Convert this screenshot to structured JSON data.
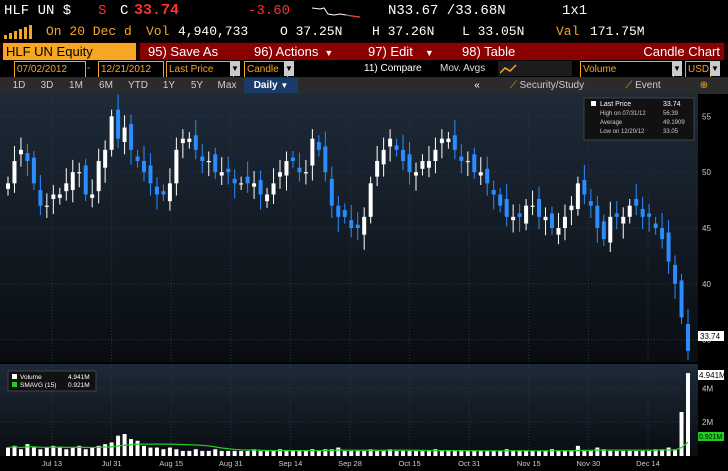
{
  "quote": {
    "ticker": "HLF UN $",
    "status": "S",
    "c_label": "C",
    "last": "33.74",
    "change": "-3.60",
    "n_quote": "N33.67 /33.68N",
    "size": "1x1",
    "time_label": "On 20 Dec d",
    "vol_label": "Vol",
    "volume": "4,940,733",
    "open": "O 37.25N",
    "high": "H 37.26N",
    "low": "L 33.05N",
    "val_label": "Val",
    "value": "171.75M"
  },
  "toolbar": {
    "security": "HLF UN Equity",
    "save_as": "95) Save As",
    "actions": "96) Actions",
    "edit": "97) Edit",
    "table": "98) Table",
    "title": "Candle Chart"
  },
  "settings": {
    "start_date": "07/02/2012",
    "end_date": "12/21/2012",
    "field": "Last Price",
    "chart_type": "Candle",
    "compare": "11) Compare",
    "mov_avgs": "Mov. Avgs",
    "lower_study": "Volume",
    "currency": "USD"
  },
  "periods": [
    "1D",
    "3D",
    "1M",
    "6M",
    "YTD",
    "1Y",
    "5Y",
    "Max"
  ],
  "frequency": "Daily",
  "tabs": {
    "study": "Security/Study",
    "event": "Event",
    "collapse": "«"
  },
  "colors": {
    "accent": "#f5a623",
    "up": "#ffffff",
    "down": "#2a8cff",
    "negative": "#ff3030",
    "volume_ma": "#22cc22"
  },
  "legend_main": {
    "last_price_label": "Last Price",
    "last_price": "33.74",
    "high_label": "High on 07/31/12",
    "high": "56.39",
    "average_label": "Average",
    "average": "49.1909",
    "low_label": "Low on 12/20/12",
    "low": "33.05"
  },
  "legend_volume": {
    "volume_label": "Volume",
    "volume": "4.941M",
    "smavg_label": "SMAVG (15)",
    "smavg": "0.921M"
  },
  "chart_data": [
    {
      "type": "candle",
      "x_ticks": [
        "Jul 13",
        "Jul 31",
        "Aug 15",
        "Aug 31",
        "Sep 14",
        "Sep 28",
        "Oct 15",
        "Oct 31",
        "Nov 15",
        "Nov 30",
        "Dec 14"
      ],
      "y_ticks": [
        35,
        40,
        45,
        50,
        55
      ],
      "ylim": [
        33,
        57
      ],
      "last_label": "33.74",
      "closes": [
        49,
        51,
        52,
        51,
        49,
        47,
        47,
        48,
        48,
        49,
        50,
        50,
        48,
        48,
        51,
        52,
        55,
        53,
        54,
        52,
        51,
        50,
        49,
        48,
        48,
        49,
        52,
        53,
        53,
        52,
        51,
        51,
        50,
        50,
        50,
        49,
        49,
        49,
        49,
        48,
        48,
        49,
        50,
        51,
        51,
        50,
        50,
        53,
        52,
        50,
        47,
        46,
        46,
        45,
        45,
        46,
        49,
        51,
        52,
        53,
        52,
        51,
        50,
        50,
        51,
        51,
        52,
        53,
        53,
        52,
        51,
        51,
        50,
        50,
        49,
        48,
        47,
        46,
        46,
        46,
        47,
        47,
        46,
        46,
        45,
        45,
        46,
        47,
        49,
        48,
        47,
        45,
        44,
        46,
        46,
        46,
        47,
        47,
        46,
        46,
        45,
        44,
        42,
        40,
        37,
        34
      ]
    },
    {
      "type": "bar",
      "name": "Volume",
      "y_ticks_labels": [
        "2M",
        "4M"
      ],
      "ylim": [
        0,
        5.2
      ],
      "last_label": "4.941M",
      "ma_label": "0.921M",
      "values": [
        0.5,
        0.6,
        0.4,
        0.7,
        0.5,
        0.4,
        0.5,
        0.6,
        0.5,
        0.4,
        0.5,
        0.6,
        0.4,
        0.5,
        0.6,
        0.7,
        0.8,
        1.2,
        1.3,
        1.0,
        0.9,
        0.6,
        0.5,
        0.5,
        0.4,
        0.5,
        0.4,
        0.3,
        0.3,
        0.4,
        0.3,
        0.3,
        0.4,
        0.3,
        0.3,
        0.3,
        0.3,
        0.3,
        0.4,
        0.3,
        0.3,
        0.3,
        0.4,
        0.3,
        0.3,
        0.3,
        0.3,
        0.4,
        0.3,
        0.4,
        0.4,
        0.5,
        0.3,
        0.3,
        0.3,
        0.3,
        0.4,
        0.3,
        0.3,
        0.4,
        0.3,
        0.3,
        0.3,
        0.3,
        0.3,
        0.3,
        0.4,
        0.3,
        0.3,
        0.3,
        0.3,
        0.3,
        0.3,
        0.3,
        0.3,
        0.3,
        0.3,
        0.4,
        0.3,
        0.3,
        0.3,
        0.3,
        0.3,
        0.3,
        0.4,
        0.3,
        0.3,
        0.3,
        0.6,
        0.3,
        0.3,
        0.5,
        0.4,
        0.3,
        0.3,
        0.3,
        0.3,
        0.3,
        0.3,
        0.3,
        0.4,
        0.4,
        0.5,
        0.4,
        2.6,
        4.9
      ]
    }
  ]
}
